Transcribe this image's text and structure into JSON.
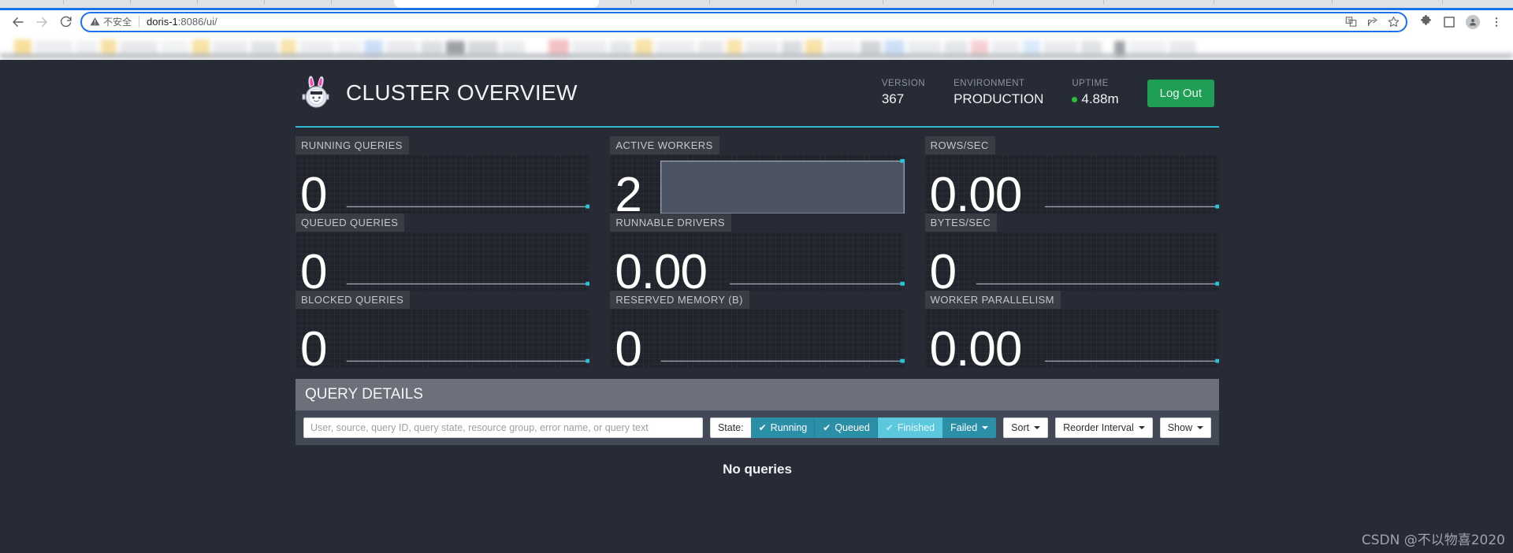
{
  "browser": {
    "nav": {
      "back_icon": "arrow-left-icon",
      "forward_icon": "arrow-right-icon",
      "reload_icon": "reload-icon"
    },
    "omnibox": {
      "security_icon": "warning-triangle-icon",
      "security_label": "不安全",
      "url_host": "doris-1",
      "url_rest": ":8086/ui/",
      "translate_icon": "translate-icon",
      "share_icon": "share-icon",
      "bookmark_icon": "star-icon"
    },
    "toolbar_right": {
      "extensions_icon": "puzzle-piece-icon",
      "sidepanel_icon": "side-panel-icon",
      "profile_icon": "account-avatar-icon",
      "menu_icon": "three-dot-menu-icon"
    }
  },
  "header": {
    "logo_icon": "bunny-astronaut-logo-icon",
    "title": "CLUSTER OVERVIEW",
    "stats": [
      {
        "label": "VERSION",
        "value": "367",
        "has_dot": false
      },
      {
        "label": "ENVIRONMENT",
        "value": "PRODUCTION",
        "has_dot": false
      },
      {
        "label": "UPTIME",
        "value": "4.88m",
        "has_dot": true
      }
    ],
    "logout_label": "Log Out",
    "accent_color": "#2fb8d4",
    "dot_color": "#28c236",
    "logout_color": "#1f9e56"
  },
  "stats": {
    "tiles": [
      {
        "label": "RUNNING QUERIES",
        "value": "0",
        "spark": "line"
      },
      {
        "label": "ACTIVE WORKERS",
        "value": "2",
        "spark": "area"
      },
      {
        "label": "ROWS/SEC",
        "value": "0.00",
        "spark": "line-short"
      },
      {
        "label": "QUEUED QUERIES",
        "value": "0",
        "spark": "line"
      },
      {
        "label": "RUNNABLE DRIVERS",
        "value": "0.00",
        "spark": "line-short"
      },
      {
        "label": "BYTES/SEC",
        "value": "0",
        "spark": "line"
      },
      {
        "label": "BLOCKED QUERIES",
        "value": "0",
        "spark": "line"
      },
      {
        "label": "RESERVED MEMORY (B)",
        "value": "0",
        "spark": "line"
      },
      {
        "label": "WORKER PARALLELISM",
        "value": "0.00",
        "spark": "line-short"
      }
    ],
    "spark_line_color": "#9aa3b4",
    "spark_dot_color": "#26c6da",
    "spark_area_fill": "#4b5262"
  },
  "query_details": {
    "title": "QUERY DETAILS",
    "search_placeholder": "User, source, query ID, query state, resource group, error name, or query text",
    "search_value": "",
    "state_label": "State:",
    "state_buttons": [
      {
        "label": "Running",
        "checked": true,
        "active": true,
        "hover": false,
        "caret": false
      },
      {
        "label": "Queued",
        "checked": true,
        "active": true,
        "hover": false,
        "caret": false
      },
      {
        "label": "Finished",
        "checked": true,
        "active": true,
        "hover": true,
        "caret": false
      },
      {
        "label": "Failed",
        "checked": false,
        "active": true,
        "hover": false,
        "caret": true
      }
    ],
    "dropdowns": [
      {
        "label": "Sort"
      },
      {
        "label": "Reorder Interval"
      },
      {
        "label": "Show"
      }
    ],
    "empty_message": "No queries"
  },
  "watermark": "CSDN @不以物喜2020"
}
